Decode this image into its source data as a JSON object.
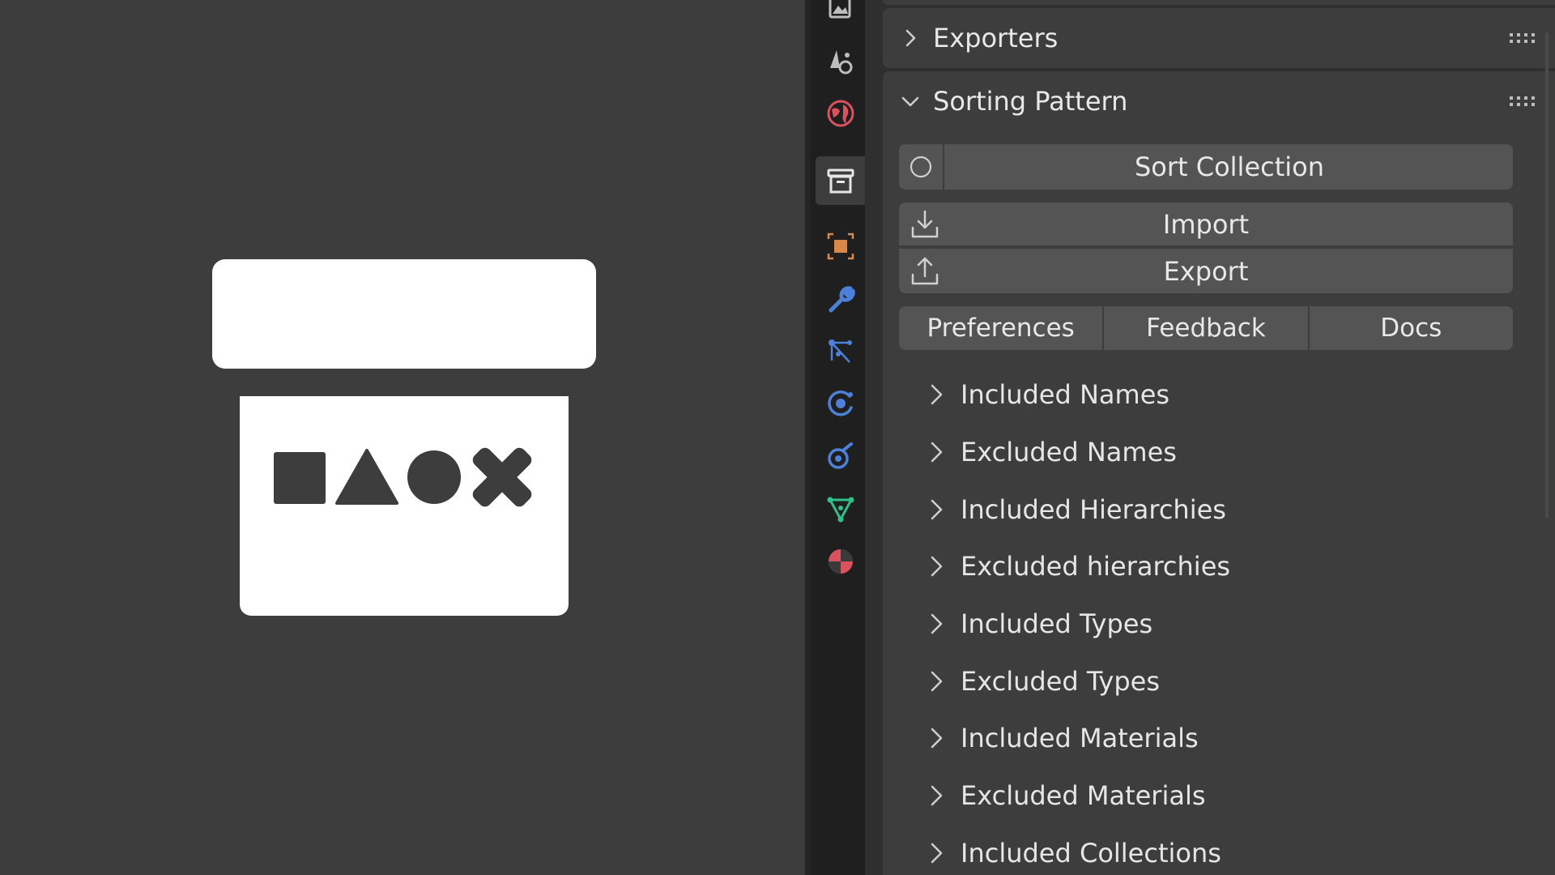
{
  "logo": {
    "shape_icons": [
      "square-icon",
      "triangle-icon",
      "circle-icon",
      "cross-icon"
    ]
  },
  "tabs": [
    {
      "name": "render-tab",
      "icon": "image-icon"
    },
    {
      "name": "scene-tab",
      "icon": "scene-icon"
    },
    {
      "name": "world-tab",
      "icon": "world-icon"
    },
    {
      "name": "collection-tab",
      "icon": "collection-box-icon",
      "active": true
    },
    {
      "name": "object-tab",
      "icon": "object-icon"
    },
    {
      "name": "modifier-tab",
      "icon": "wrench-icon"
    },
    {
      "name": "particles-tab",
      "icon": "particles-icon"
    },
    {
      "name": "physics-tab",
      "icon": "physics-icon"
    },
    {
      "name": "constraints-tab",
      "icon": "constraint-icon"
    },
    {
      "name": "data-tab",
      "icon": "mesh-data-icon"
    },
    {
      "name": "material-tab",
      "icon": "material-icon"
    }
  ],
  "colors": {
    "accent_orange": "#d8894a",
    "accent_blue": "#4d80d9",
    "accent_green": "#2fc18a",
    "accent_red": "#d9525e"
  },
  "exporters": {
    "title": "Exporters",
    "expanded": false
  },
  "sorting": {
    "title": "Sorting Pattern",
    "expanded": true,
    "sort_collection_label": "Sort Collection",
    "import_label": "Import",
    "export_label": "Export",
    "preferences_label": "Preferences",
    "feedback_label": "Feedback",
    "docs_label": "Docs",
    "items": [
      "Included Names",
      "Excluded Names",
      "Included Hierarchies",
      "Excluded hierarchies",
      "Included Types",
      "Excluded Types",
      "Included Materials",
      "Excluded Materials",
      "Included Collections"
    ]
  }
}
